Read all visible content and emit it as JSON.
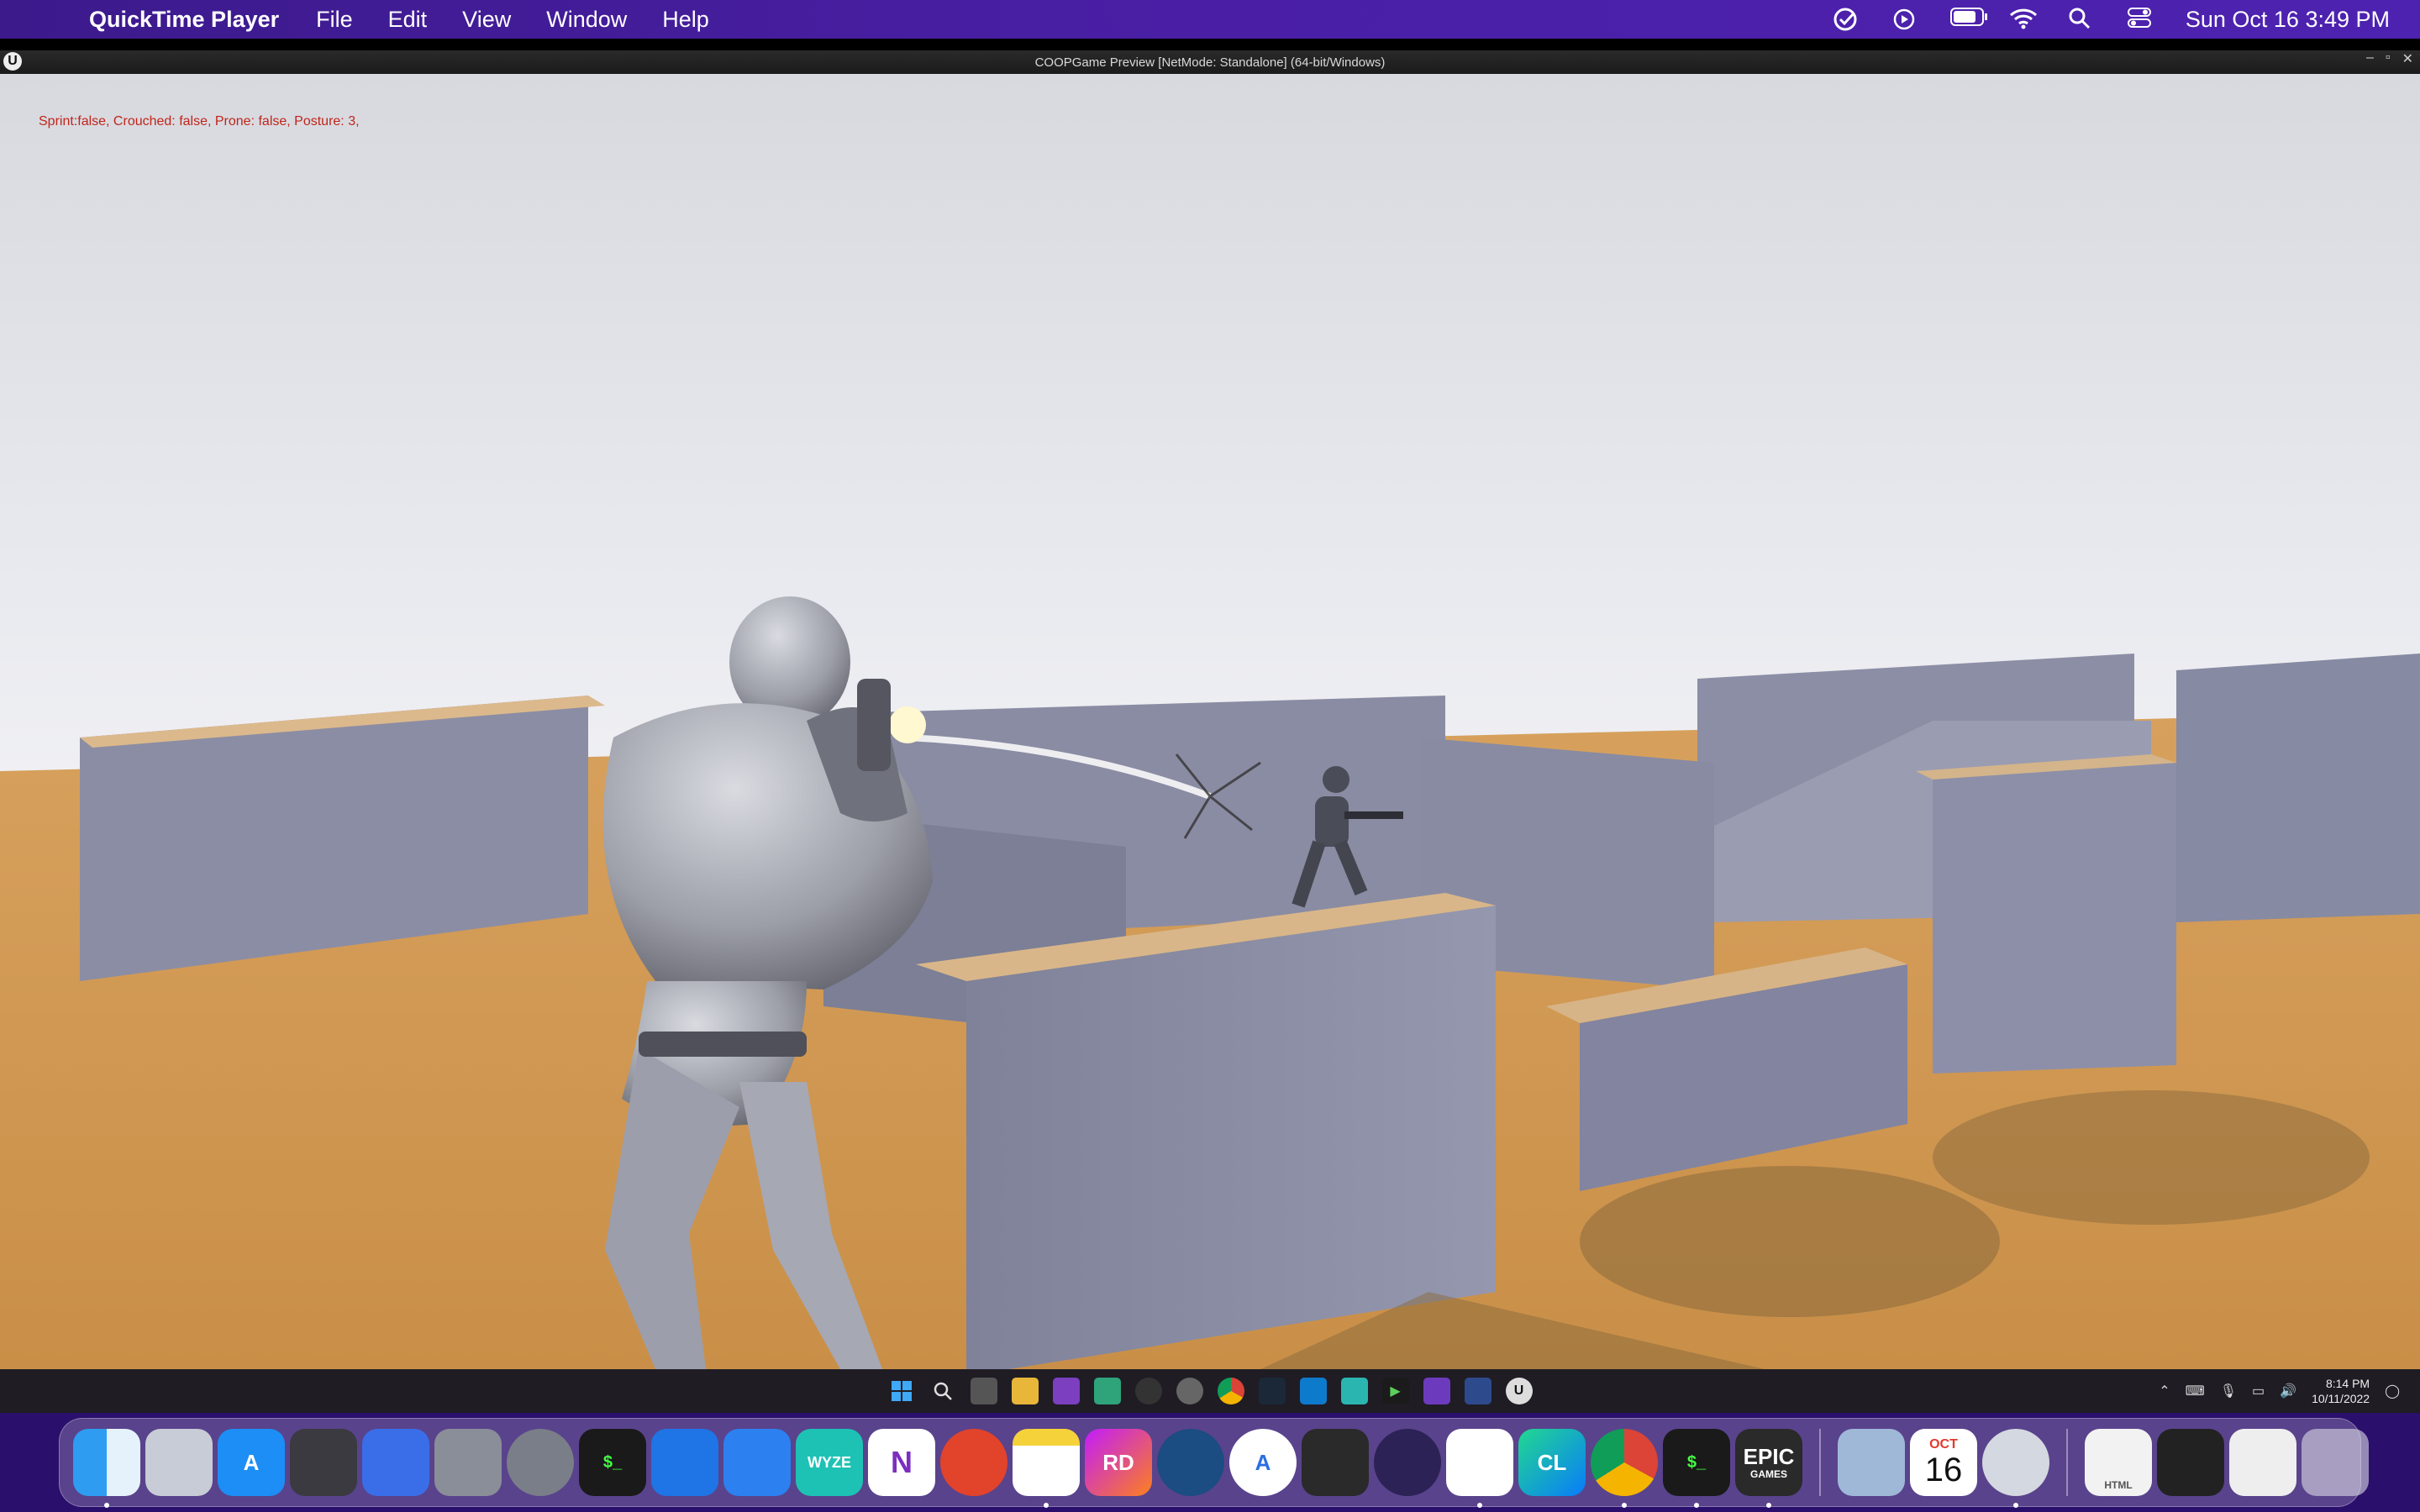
{
  "menubar": {
    "app_name": "QuickTime Player",
    "menus": [
      "File",
      "Edit",
      "View",
      "Window",
      "Help"
    ],
    "clock": "Sun Oct 16  3:49 PM"
  },
  "window": {
    "title": "COOPGame Preview [NetMode: Standalone]  (64-bit/Windows)"
  },
  "game": {
    "debug_text": "Sprint:false, Crouched: false, Prone: false, Posture: 3,"
  },
  "taskbar": {
    "time": "8:14 PM",
    "date": "10/11/2022",
    "icons": [
      "windows-start-icon",
      "search-icon",
      "task-view-icon",
      "file-explorer-icon",
      "onenote-icon",
      "app-icon",
      "obs-icon",
      "app-icon-2",
      "chrome-icon",
      "steam-icon",
      "vscode-icon",
      "app-icon-3",
      "rider-run-icon",
      "visual-studio-icon",
      "terminal-icon",
      "unreal-engine-icon"
    ]
  },
  "dock": {
    "wyze_label": "WYZE",
    "rider_label": "RD",
    "clion_label": "CL",
    "epic_label_1": "EPIC",
    "epic_label_2": "GAMES",
    "calendar_month": "OCT",
    "calendar_day": "16",
    "file_label": "HTML"
  },
  "colors": {
    "menubar": "#4a1fa6",
    "debug_text": "#c0251a",
    "floor": "#d9a25c",
    "walls": "#8d8fa8"
  }
}
